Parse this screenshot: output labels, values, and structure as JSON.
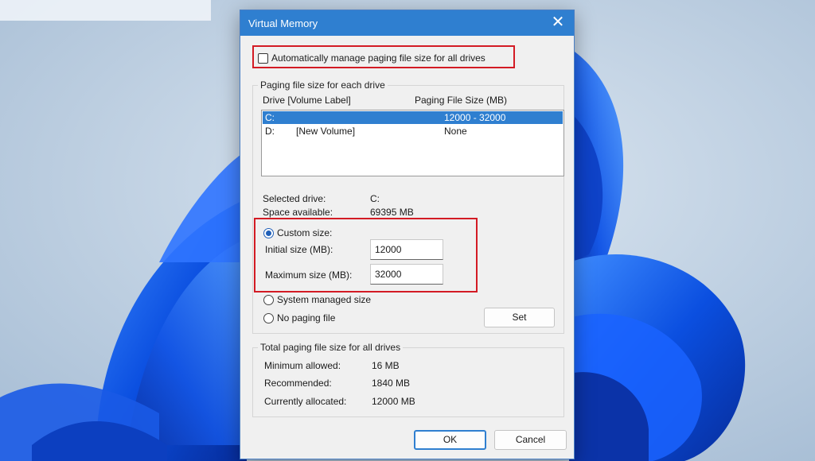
{
  "dialog": {
    "title": "Virtual Memory",
    "close_label": "✕"
  },
  "auto_manage": {
    "label": "Automatically manage paging file size for all drives",
    "checked": false
  },
  "paging_group": {
    "legend": "Paging file size for each drive",
    "col_drive": "Drive  [Volume Label]",
    "col_size": "Paging File Size (MB)",
    "rows": [
      {
        "drive": "C:",
        "label": "",
        "size": "12000 - 32000",
        "selected": true
      },
      {
        "drive": "D:",
        "label": "[New Volume]",
        "size": "None",
        "selected": false
      }
    ],
    "selected_drive_label": "Selected drive:",
    "selected_drive_value": "C:",
    "space_available_label": "Space available:",
    "space_available_value": "69395 MB",
    "custom_size_label": "Custom size:",
    "initial_size_label": "Initial size (MB):",
    "initial_size_value": "12000",
    "maximum_size_label": "Maximum size (MB):",
    "maximum_size_value": "32000",
    "system_managed_label": "System managed size",
    "no_paging_label": "No paging file",
    "set_label": "Set"
  },
  "total_group": {
    "legend": "Total paging file size for all drives",
    "minimum_label": "Minimum allowed:",
    "minimum_value": "16 MB",
    "recommended_label": "Recommended:",
    "recommended_value": "1840 MB",
    "allocated_label": "Currently allocated:",
    "allocated_value": "12000 MB"
  },
  "buttons": {
    "ok": "OK",
    "cancel": "Cancel"
  },
  "colors": {
    "titlebar": "#2f7fd0",
    "highlight": "#d31b24",
    "selection": "#2f7fd0"
  }
}
